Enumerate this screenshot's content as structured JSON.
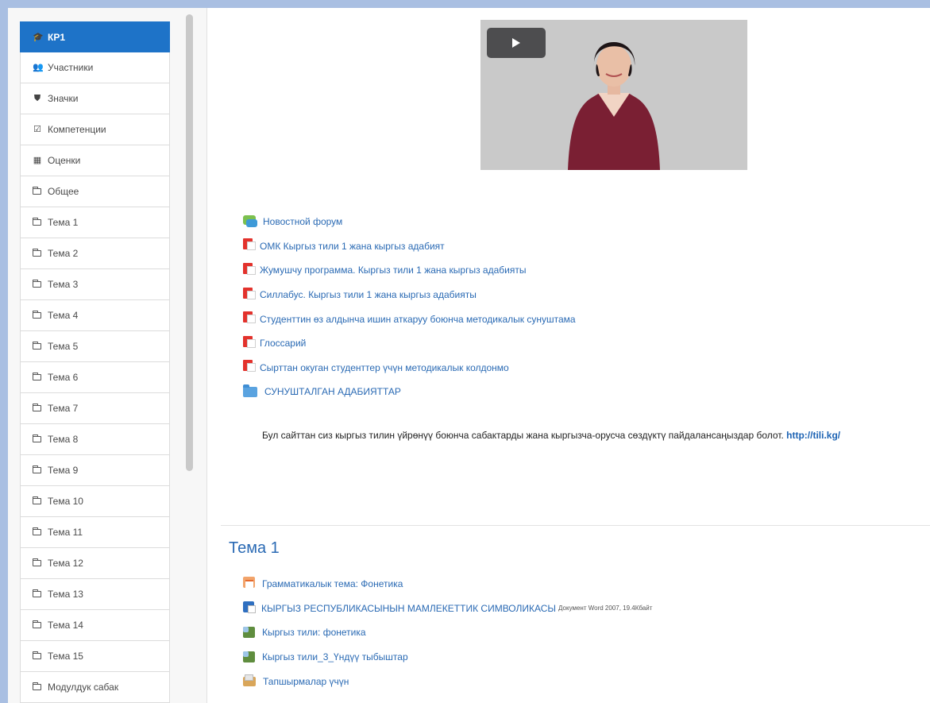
{
  "sidebar": {
    "items": [
      {
        "label": "КР1",
        "icon": "graduation-cap-icon",
        "active": true
      },
      {
        "label": "Участники",
        "icon": "users-icon"
      },
      {
        "label": "Значки",
        "icon": "shield-icon"
      },
      {
        "label": "Компетенции",
        "icon": "checkbox-icon"
      },
      {
        "label": "Оценки",
        "icon": "table-icon"
      },
      {
        "label": "Общее",
        "icon": "folder-icon"
      },
      {
        "label": "Тема 1",
        "icon": "folder-icon"
      },
      {
        "label": "Тема 2",
        "icon": "folder-icon"
      },
      {
        "label": "Тема 3",
        "icon": "folder-icon"
      },
      {
        "label": "Тема 4",
        "icon": "folder-icon"
      },
      {
        "label": "Тема 5",
        "icon": "folder-icon"
      },
      {
        "label": "Тема 6",
        "icon": "folder-icon"
      },
      {
        "label": "Тема 7",
        "icon": "folder-icon"
      },
      {
        "label": "Тема 8",
        "icon": "folder-icon"
      },
      {
        "label": "Тема 9",
        "icon": "folder-icon"
      },
      {
        "label": "Тема 10",
        "icon": "folder-icon"
      },
      {
        "label": "Тема 11",
        "icon": "folder-icon"
      },
      {
        "label": "Тема 12",
        "icon": "folder-icon"
      },
      {
        "label": "Тема 13",
        "icon": "folder-icon"
      },
      {
        "label": "Тема 14",
        "icon": "folder-icon"
      },
      {
        "label": "Тема 15",
        "icon": "folder-icon"
      },
      {
        "label": "Модулдук сабак",
        "icon": "folder-icon"
      }
    ]
  },
  "general": {
    "resources": [
      {
        "label": "Новостной форум",
        "icon": "forum-icon"
      },
      {
        "label": "ОМК Кыргыз тили 1 жана кыргыз адабият",
        "icon": "pdf-icon"
      },
      {
        "label": "Жумушчу программа. Кыргыз тили 1 жана кыргыз адабияты",
        "icon": "pdf-icon"
      },
      {
        "label": "Силлабус. Кыргыз тили 1 жана кыргыз адабияты",
        "icon": "pdf-icon"
      },
      {
        "label": "Студенттин өз алдынча ишин аткаруу боюнча методикалык сунуштама",
        "icon": "pdf-icon"
      },
      {
        "label": "Глоссарий",
        "icon": "pdf-icon"
      },
      {
        "label": "Сырттан окуган студенттер үчүн методикалык колдонмо",
        "icon": "pdf-icon"
      },
      {
        "label": "СУНУШТАЛГАН АДАБИЯТТАР",
        "icon": "folder-icon"
      }
    ],
    "info_text": "Бул сайттан сиз кыргыз тилин үйрөнүү боюнча сабактарды жана кыргызча-орусча сөздүктү пайдалансаңыздар болот.",
    "info_link": "http://tili.kg/"
  },
  "section1": {
    "title": "Тема 1",
    "resources": [
      {
        "label": "Грамматикалык тема: Фонетика",
        "meta": "",
        "icon": "lesson-icon"
      },
      {
        "label": "КЫРГЫЗ РЕСПУБЛИКАСЫНЫН МАМЛЕКЕТТИК СИМВОЛИКАСЫ",
        "meta": "Документ Word 2007, 19.4Кбайт",
        "icon": "word-doc-icon"
      },
      {
        "label": "Кыргыз тили: фонетика",
        "meta": "",
        "icon": "scorm-package-icon"
      },
      {
        "label": "Кыргыз тили_3_Үндүү тыбыштар",
        "meta": "",
        "icon": "scorm-package-icon"
      },
      {
        "label": "Тапшырмалар үчүн",
        "meta": "",
        "icon": "assignment-icon"
      }
    ]
  }
}
